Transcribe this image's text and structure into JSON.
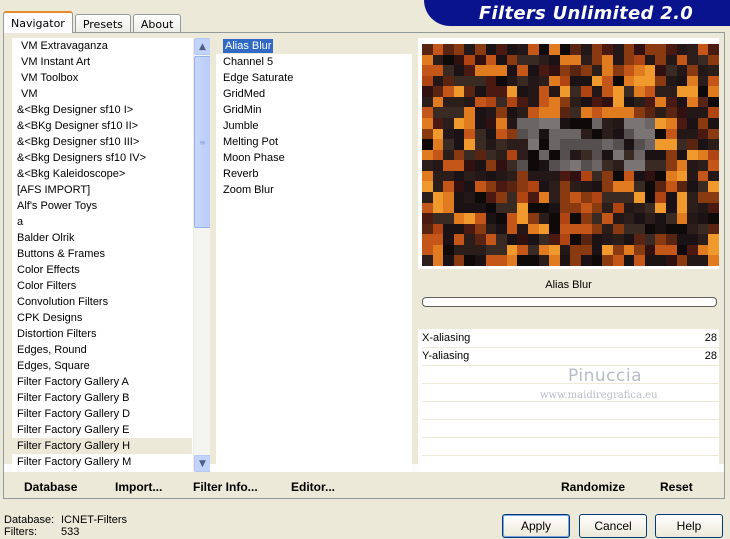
{
  "tabs": [
    {
      "label": "Navigator"
    },
    {
      "label": "Presets"
    },
    {
      "label": "About"
    }
  ],
  "banner": {
    "title": "Filters Unlimited 2.0"
  },
  "categories": [
    "VM Extravaganza",
    "VM Instant Art",
    "VM Toolbox",
    "VM",
    "&<Bkg Designer sf10 I>",
    "&<BKg Designer sf10 II>",
    "&<Bkg Designer sf10 III>",
    "&<Bkg Designers sf10 IV>",
    "&<Bkg Kaleidoscope>",
    "[AFS IMPORT]",
    "Alf's Power Toys",
    "a",
    "Balder Olrik",
    "Buttons & Frames",
    "Color Effects",
    "Color Filters",
    "Convolution Filters",
    "CPK Designs",
    "Distortion Filters",
    "Edges, Round",
    "Edges, Square",
    "Filter Factory Gallery A",
    "Filter Factory Gallery B",
    "Filter Factory Gallery D",
    "Filter Factory Gallery E",
    "Filter Factory Gallery H",
    "Filter Factory Gallery M"
  ],
  "selected_category": "Filter Factory Gallery H",
  "filters": [
    "Alias Blur",
    "Channel 5",
    "Edge Saturate",
    "GridMed",
    "GridMin",
    "Jumble",
    "Melting Pot",
    "Moon Phase",
    "Reverb",
    "Zoom Blur"
  ],
  "selected_filter": "Alias Blur",
  "preview": {
    "filter_name": "Alias Blur"
  },
  "params": [
    {
      "label": "X-aliasing",
      "value": "28"
    },
    {
      "label": "Y-aliasing",
      "value": "28"
    }
  ],
  "watermark": {
    "line1": "Pinuccia",
    "line2": "www.maidiregrafica.eu"
  },
  "bottom_bar": {
    "database": "Database",
    "import": "Import...",
    "filter_info": "Filter Info...",
    "editor": "Editor...",
    "randomize": "Randomize",
    "reset": "Reset"
  },
  "footer": {
    "database_label": "Database:",
    "database_value": "ICNET-Filters",
    "filters_label": "Filters:",
    "filters_value": "533"
  },
  "buttons": {
    "apply": "Apply",
    "cancel": "Cancel",
    "help": "Help"
  },
  "colors": {
    "banner": "#08138d",
    "selection": "#316ac5",
    "tab_accent": "#e68b2c"
  }
}
